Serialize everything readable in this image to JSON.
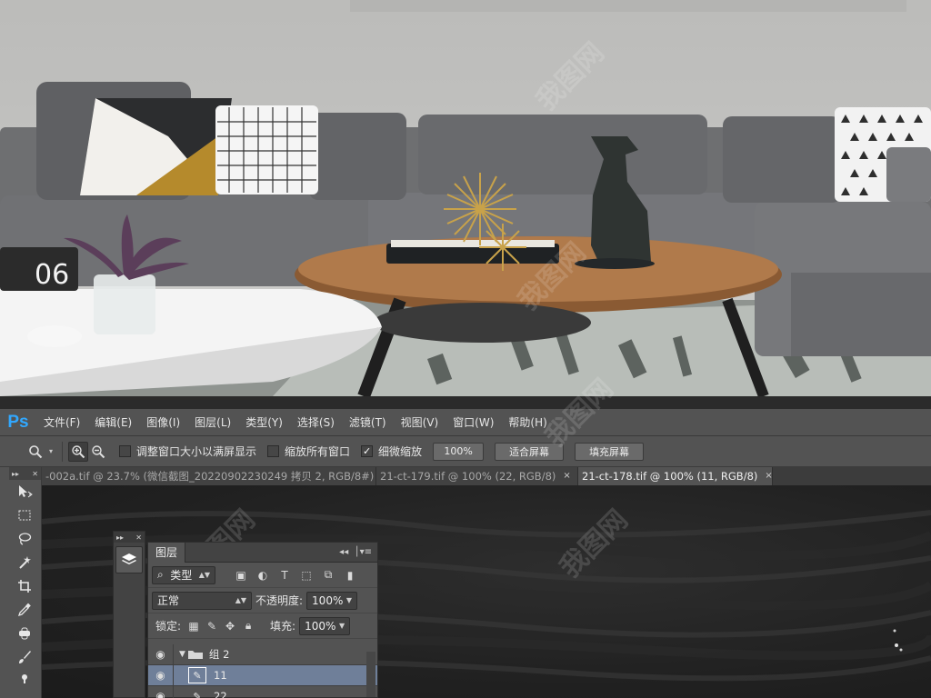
{
  "photo": {
    "clock_digits": "06"
  },
  "watermark": {
    "text": "我图网"
  },
  "app": {
    "logo": "Ps"
  },
  "menu": [
    {
      "label": "文件(F)"
    },
    {
      "label": "编辑(E)"
    },
    {
      "label": "图像(I)"
    },
    {
      "label": "图层(L)"
    },
    {
      "label": "类型(Y)"
    },
    {
      "label": "选择(S)"
    },
    {
      "label": "滤镜(T)"
    },
    {
      "label": "视图(V)"
    },
    {
      "label": "窗口(W)"
    },
    {
      "label": "帮助(H)"
    }
  ],
  "options": {
    "tool_icon": "zoom-icon",
    "resize_windows": {
      "label": "调整窗口大小以满屏显示",
      "checked": false
    },
    "zoom_all": {
      "label": "缩放所有窗口",
      "checked": false
    },
    "scrubby_zoom": {
      "label": "细微缩放",
      "checked": true
    },
    "zoom_percent": "100%",
    "fit_screen": "适合屏幕",
    "fill_screen": "填充屏幕"
  },
  "tabs": [
    {
      "title": "-002a.tif @ 23.7% (微信截图_20220902230249 拷贝 2, RGB/8#) *",
      "active": false
    },
    {
      "title": "21-ct-179.tif @ 100% (22, RGB/8)",
      "active": false
    },
    {
      "title": "21-ct-178.tif @ 100% (11, RGB/8)",
      "active": true
    }
  ],
  "tab_close": "×",
  "layers_panel": {
    "title": "图层",
    "filter_kind": "类型",
    "blend_mode": "正常",
    "opacity_label": "不透明度:",
    "opacity_value": "100%",
    "lock_label": "锁定:",
    "fill_label": "填充:",
    "fill_value": "100%",
    "layers": [
      {
        "name": "组 2",
        "type": "group",
        "selected": false
      },
      {
        "name": "11",
        "type": "layer",
        "selected": true
      },
      {
        "name": "22",
        "type": "layer",
        "selected": false
      }
    ]
  }
}
